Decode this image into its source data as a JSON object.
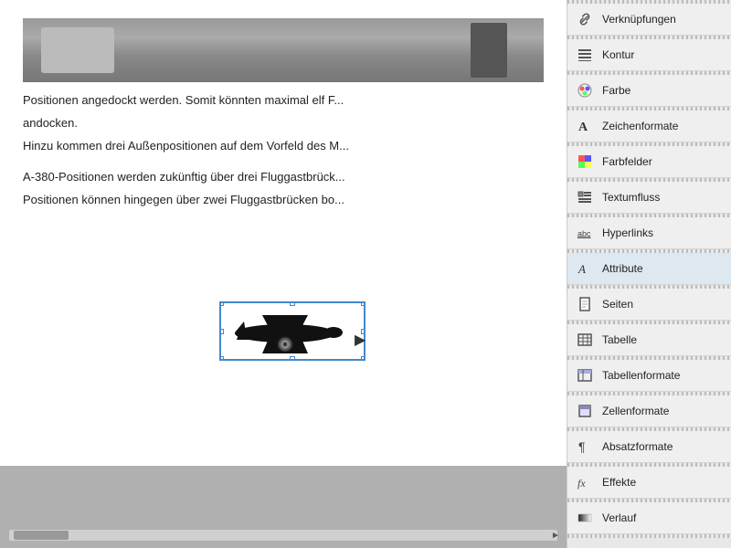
{
  "main": {
    "page_text_1": "Positionen angedockt werden. Somit könnten maximal elf F...",
    "page_text_2": "andocken.",
    "page_text_3": "Hinzu kommen drei Außenpositionen auf dem Vorfeld des M...",
    "page_text_4": "A-380-Positionen werden zukünftig über drei Fluggastbrück...",
    "page_text_5": "Positionen können hingegen über zwei Fluggastbrücken bo..."
  },
  "panel": {
    "items": [
      {
        "id": "verknuepfungen",
        "label": "Verknüpfungen",
        "icon": "link-icon"
      },
      {
        "id": "kontur",
        "label": "Kontur",
        "icon": "kontur-icon"
      },
      {
        "id": "farbe",
        "label": "Farbe",
        "icon": "farbe-icon"
      },
      {
        "id": "zeichenformate",
        "label": "Zeichenformate",
        "icon": "zeichen-icon"
      },
      {
        "id": "farbfelder",
        "label": "Farbfelder",
        "icon": "farbfelder-icon"
      },
      {
        "id": "textumfluss",
        "label": "Textumfluss",
        "icon": "textumfluss-icon"
      },
      {
        "id": "hyperlinks",
        "label": "Hyperlinks",
        "icon": "hyperlinks-icon"
      },
      {
        "id": "attribute",
        "label": "Attribute",
        "icon": "attribute-icon",
        "active": true
      },
      {
        "id": "seiten",
        "label": "Seiten",
        "icon": "seiten-icon"
      },
      {
        "id": "tabelle",
        "label": "Tabelle",
        "icon": "tabelle-icon"
      },
      {
        "id": "tabellenformate",
        "label": "Tabellenformate",
        "icon": "tabellenformate-icon"
      },
      {
        "id": "zellenformate",
        "label": "Zellenformate",
        "icon": "zellenformate-icon"
      },
      {
        "id": "absatzformate",
        "label": "Absatzformate",
        "icon": "absatzformate-icon"
      },
      {
        "id": "effekte",
        "label": "Effekte",
        "icon": "effekte-icon"
      },
      {
        "id": "verlauf",
        "label": "Verlauf",
        "icon": "verlauf-icon"
      }
    ]
  }
}
